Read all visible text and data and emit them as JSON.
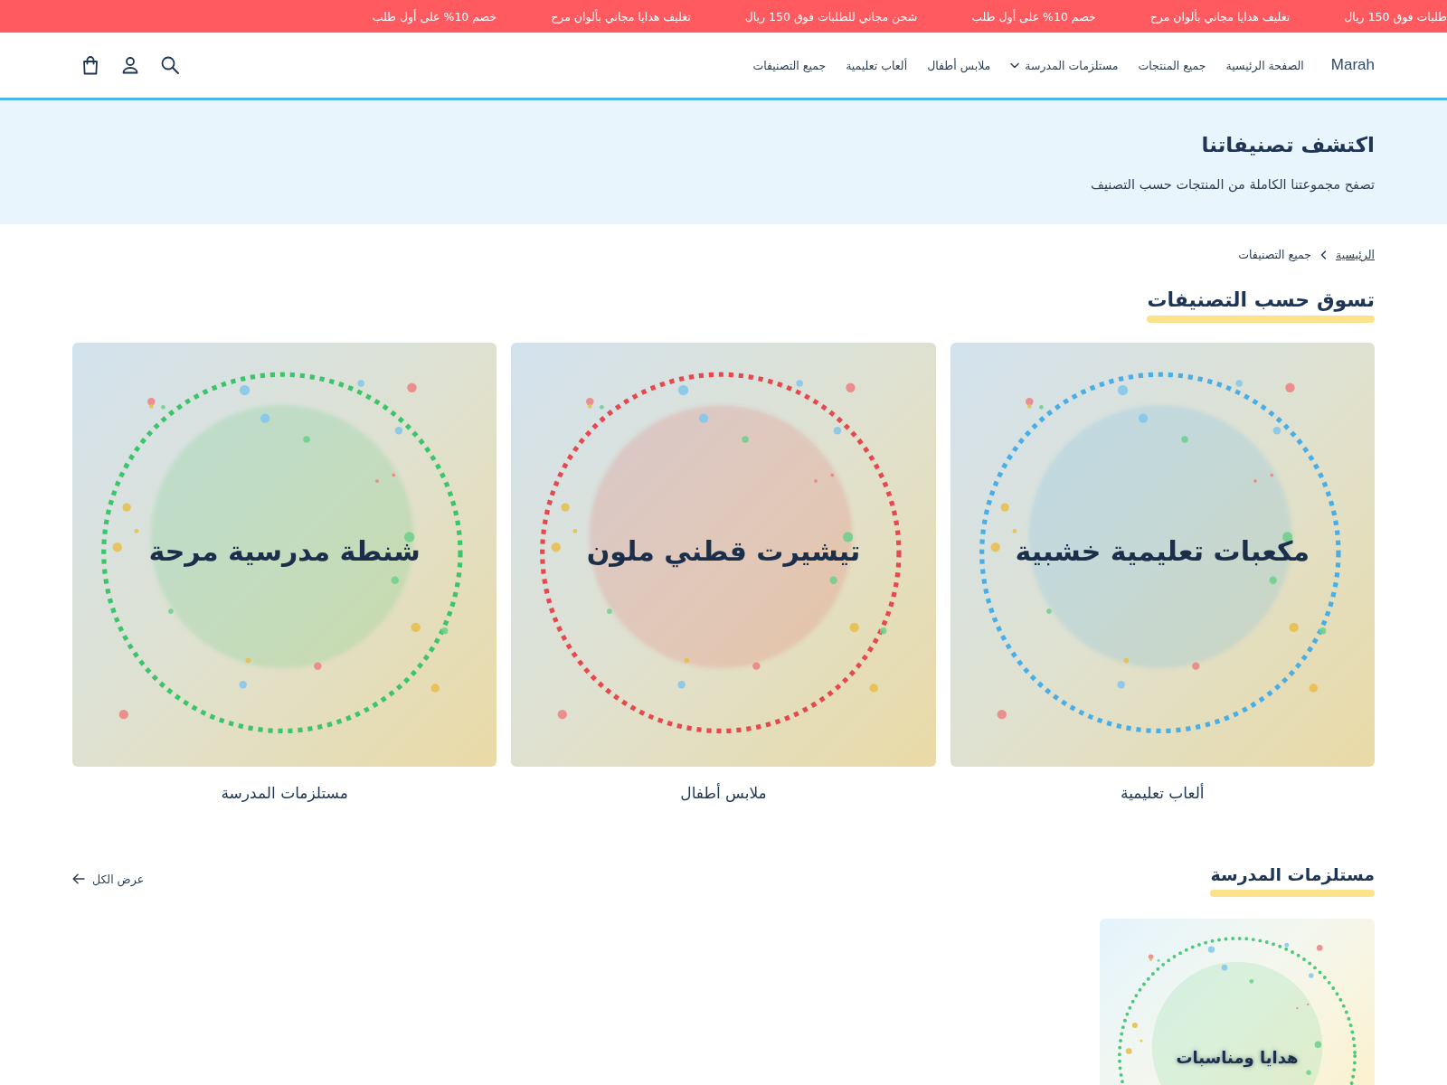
{
  "promo_bar": {
    "messages": [
      "طلبات فوق 150 ريال",
      "تغليف هدايا مجاني بألوان مرح",
      "خصم 10% على أول طلب",
      "شحن مجاني للطلبات فوق 150 ريال",
      "تغليف هدايا مجاني بألوان مرح",
      "خصم 10% على أول طلب"
    ]
  },
  "header": {
    "logo": "Marah",
    "links": [
      {
        "label": "الصفحة الرئيسية",
        "has_menu": false
      },
      {
        "label": "جميع المنتجات",
        "has_menu": false
      },
      {
        "label": "مستلزمات المدرسة",
        "has_menu": true
      },
      {
        "label": "ملابس أطفال",
        "has_menu": false
      },
      {
        "label": "ألعاب تعليمية",
        "has_menu": false
      },
      {
        "label": "جميع التصنيفات",
        "has_menu": false
      }
    ]
  },
  "hero": {
    "title": "اكتشف تصنيفاتنا",
    "subtitle": "تصفح مجموعتنا الكاملة من المنتجات حسب التصنيف"
  },
  "breadcrumb": [
    {
      "label": "الرئيسية",
      "kind": "link"
    },
    {
      "label": "جميع التصنيفات",
      "kind": "current"
    }
  ],
  "categories_section": {
    "heading": "تسوق حسب التصنيفات",
    "categories": [
      {
        "name": "ألعاب تعليمية",
        "image_text": "مكعبات تعليمية خشبية",
        "color": "#4aaee6"
      },
      {
        "name": "ملابس أطفال",
        "image_text": "تيشيرت قطني ملون",
        "color": "#e5484d"
      },
      {
        "name": "مستلزمات المدرسة",
        "image_text": "شنطة مدرسية مرحة",
        "color": "#3cc46a"
      }
    ]
  },
  "product_section": {
    "heading": "مستلزمات المدرسة",
    "view_all": "عرض الكل",
    "products": [
      {
        "image_text": "هدايا ومناسبات"
      }
    ]
  }
}
